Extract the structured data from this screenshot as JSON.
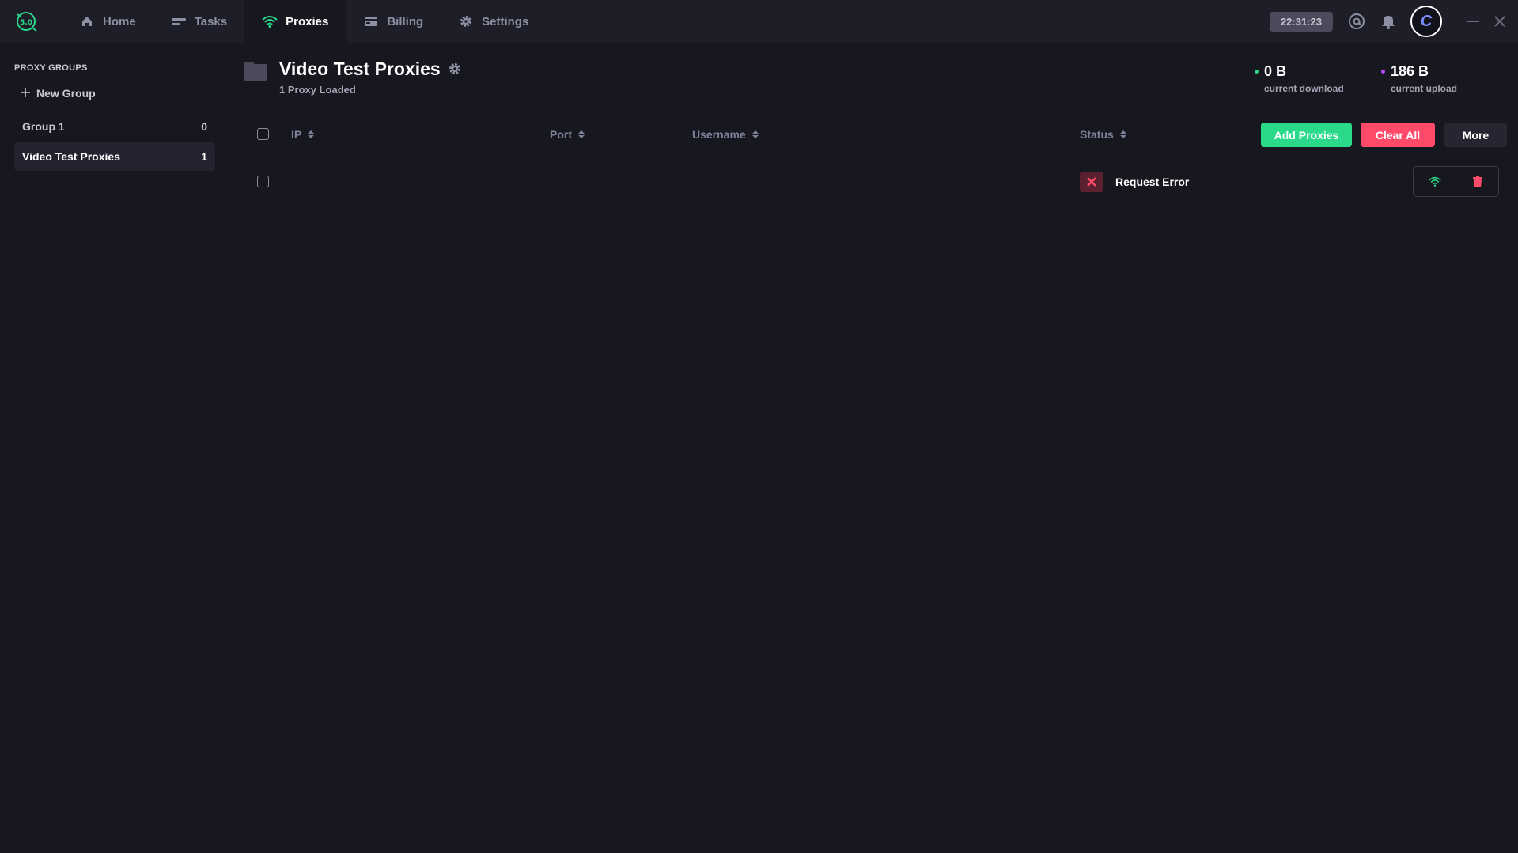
{
  "app": {
    "logo_text": "5.0"
  },
  "nav": [
    {
      "label": "Home",
      "icon": "home-icon",
      "active": false
    },
    {
      "label": "Tasks",
      "icon": "tasks-icon",
      "active": false
    },
    {
      "label": "Proxies",
      "icon": "wifi-icon",
      "active": true
    },
    {
      "label": "Billing",
      "icon": "wallet-icon",
      "active": false
    },
    {
      "label": "Settings",
      "icon": "gear-icon",
      "active": false
    }
  ],
  "topbar": {
    "clock": "22:31:23",
    "avatar_letter": "C"
  },
  "sidebar": {
    "title": "PROXY GROUPS",
    "new_group": "New Group",
    "groups": [
      {
        "name": "Group 1",
        "count": "0",
        "active": false
      },
      {
        "name": "Video Test Proxies",
        "count": "1",
        "active": true
      }
    ]
  },
  "header": {
    "title": "Video Test Proxies",
    "subtitle": "1 Proxy Loaded",
    "download": {
      "value": "0 B",
      "label": "current download",
      "color": "#2bd98a"
    },
    "upload": {
      "value": "186 B",
      "label": "current upload",
      "color": "#b24dff"
    }
  },
  "table": {
    "columns": {
      "ip": "IP",
      "port": "Port",
      "username": "Username",
      "status": "Status"
    },
    "buttons": {
      "add": "Add Proxies",
      "clear": "Clear All",
      "more": "More"
    },
    "rows": [
      {
        "ip": "",
        "port": "",
        "username": "",
        "status": "Request Error"
      }
    ]
  },
  "colors": {
    "accent_green": "#2bd98a",
    "danger": "#ff4a6a",
    "bg": "#17171f",
    "topbar": "#1e1e29"
  }
}
